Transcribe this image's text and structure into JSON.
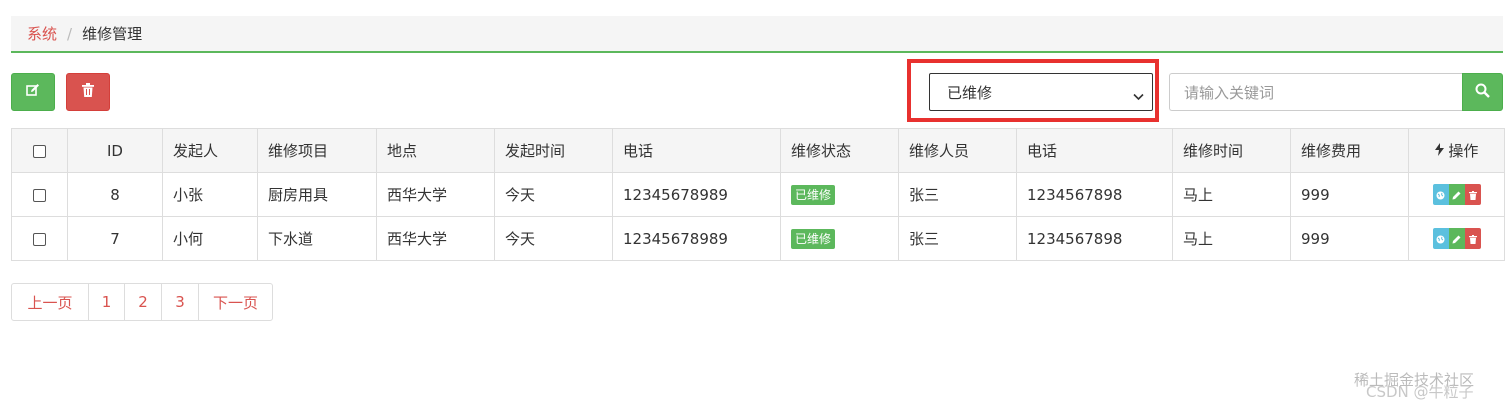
{
  "breadcrumb": {
    "root": "系统",
    "separator": "/",
    "current": "维修管理"
  },
  "toolbar": {
    "edit_icon": "edit-icon",
    "delete_icon": "trash-icon"
  },
  "filter": {
    "selected": "已维修"
  },
  "search": {
    "placeholder": "请输入关键词",
    "icon": "search-icon"
  },
  "table": {
    "headers": [
      "ID",
      "发起人",
      "维修项目",
      "地点",
      "发起时间",
      "电话",
      "维修状态",
      "维修人员",
      "电话",
      "维修时间",
      "维修费用",
      "操作"
    ],
    "rows": [
      {
        "id": "8",
        "initiator": "小张",
        "item": "厨房用具",
        "location": "西华大学",
        "time": "今天",
        "phone": "12345678989",
        "status": "已维修",
        "staff": "张三",
        "staff_phone": "1234567898",
        "repair_time": "马上",
        "cost": "999"
      },
      {
        "id": "7",
        "initiator": "小何",
        "item": "下水道",
        "location": "西华大学",
        "time": "今天",
        "phone": "12345678989",
        "status": "已维修",
        "staff": "张三",
        "staff_phone": "1234567898",
        "repair_time": "马上",
        "cost": "999"
      }
    ]
  },
  "pagination": {
    "prev": "上一页",
    "pages": [
      "1",
      "2",
      "3"
    ],
    "next": "下一页"
  },
  "watermark": {
    "line1": "稀土掘金技术社区",
    "line2": "CSDN @牛粒子"
  },
  "colors": {
    "primary_green": "#5cb85c",
    "danger_red": "#d9534f",
    "info_blue": "#5bc0de",
    "highlight": "#e8312f"
  }
}
